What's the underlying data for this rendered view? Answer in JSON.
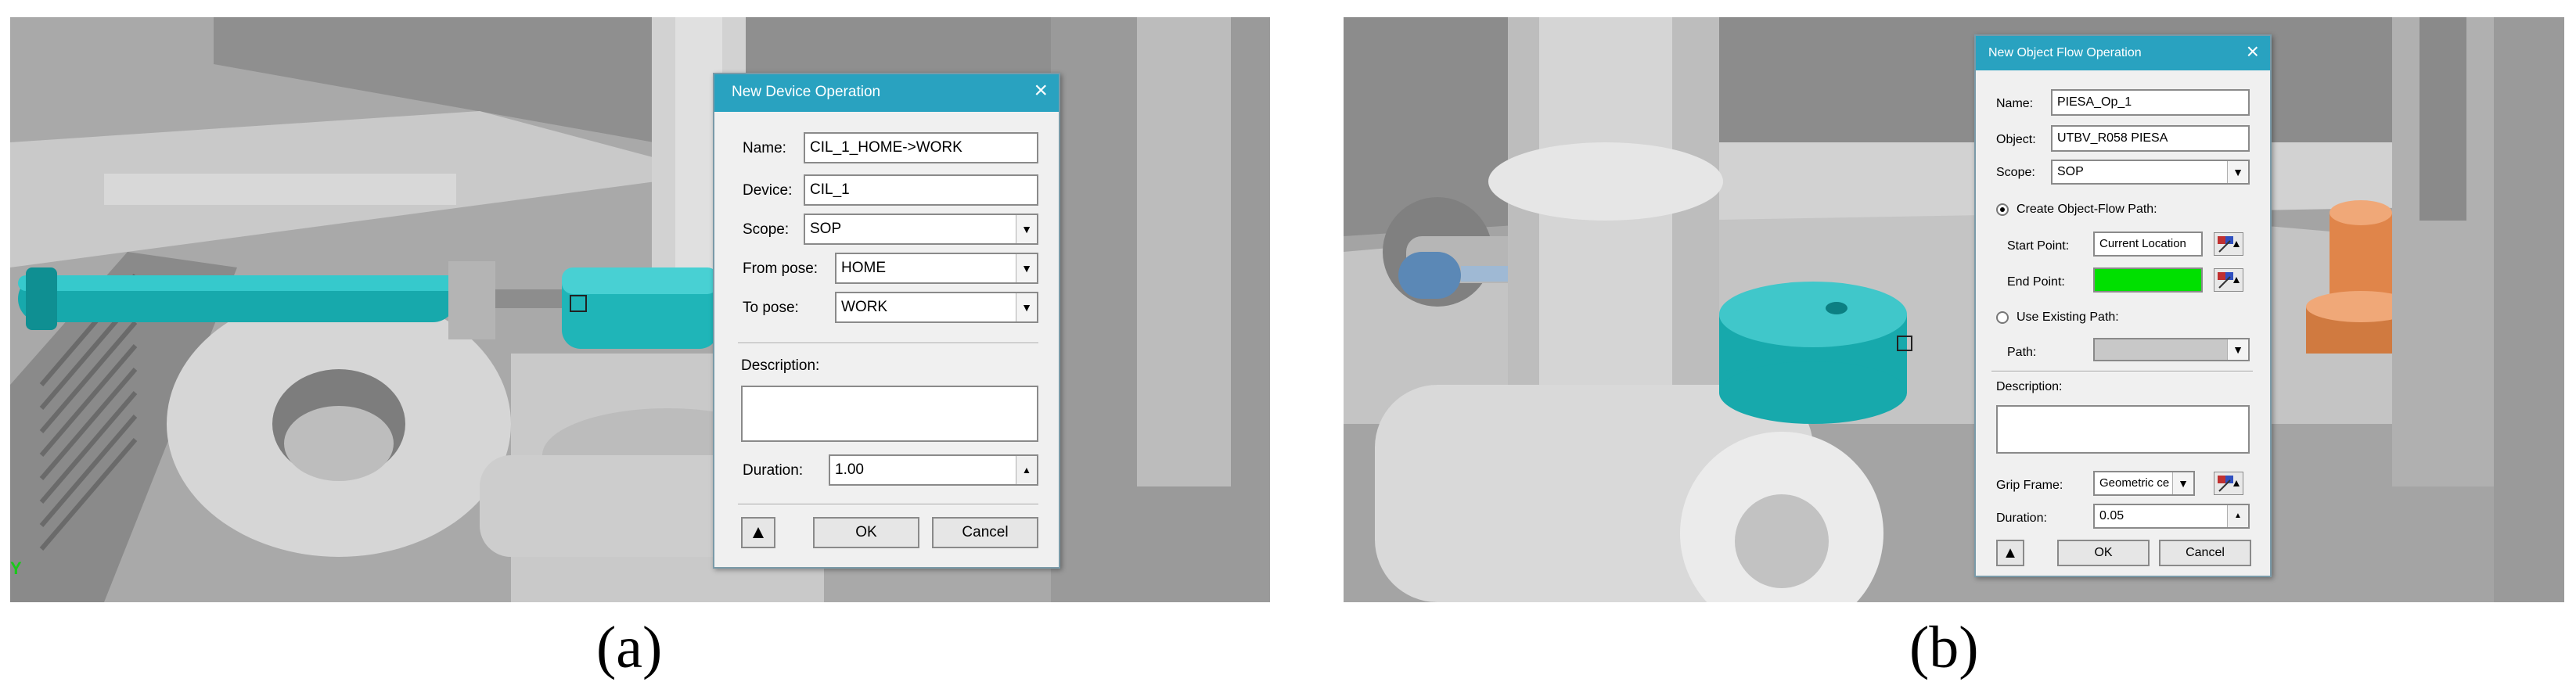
{
  "panel_a": {
    "caption": "(a)",
    "axis_letter": "Y",
    "dialog": {
      "title": "New Device Operation",
      "close": "×",
      "name_label": "Name:",
      "name_value": "CIL_1_HOME->WORK",
      "device_label": "Device:",
      "device_value": "CIL_1",
      "scope_label": "Scope:",
      "scope_value": "SOP",
      "from_pose_label": "From pose:",
      "from_pose_value": "HOME",
      "to_pose_label": "To pose:",
      "to_pose_value": "WORK",
      "description_label": "Description:",
      "description_value": "",
      "duration_label": "Duration:",
      "duration_value": "1.00",
      "ok": "OK",
      "cancel": "Cancel"
    }
  },
  "panel_b": {
    "caption": "(b)",
    "dialog": {
      "title": "New Object Flow Operation",
      "close": "×",
      "name_label": "Name:",
      "name_value": "PIESA_Op_1",
      "object_label": "Object:",
      "object_value": "UTBV_R058  PIESA",
      "scope_label": "Scope:",
      "scope_value": "SOP",
      "create_path_label": "Create Object-Flow Path:",
      "start_point_label": "Start Point:",
      "start_point_value": "Current Location",
      "end_point_label": "End Point:",
      "end_point_color": "#00e000",
      "use_existing_label": "Use Existing Path:",
      "path_label": "Path:",
      "description_label": "Description:",
      "description_value": "",
      "grip_frame_label": "Grip Frame:",
      "grip_frame_value": "Geometric ce",
      "duration_label": "Duration:",
      "duration_value": "0.05",
      "ok": "OK",
      "cancel": "Cancel"
    }
  },
  "colors": {
    "title_bar": "#29a2c0",
    "cylinder_teal": "#1fb5b8",
    "part_orange": "#e8955a",
    "scene_gray": "#a8a8a8"
  }
}
